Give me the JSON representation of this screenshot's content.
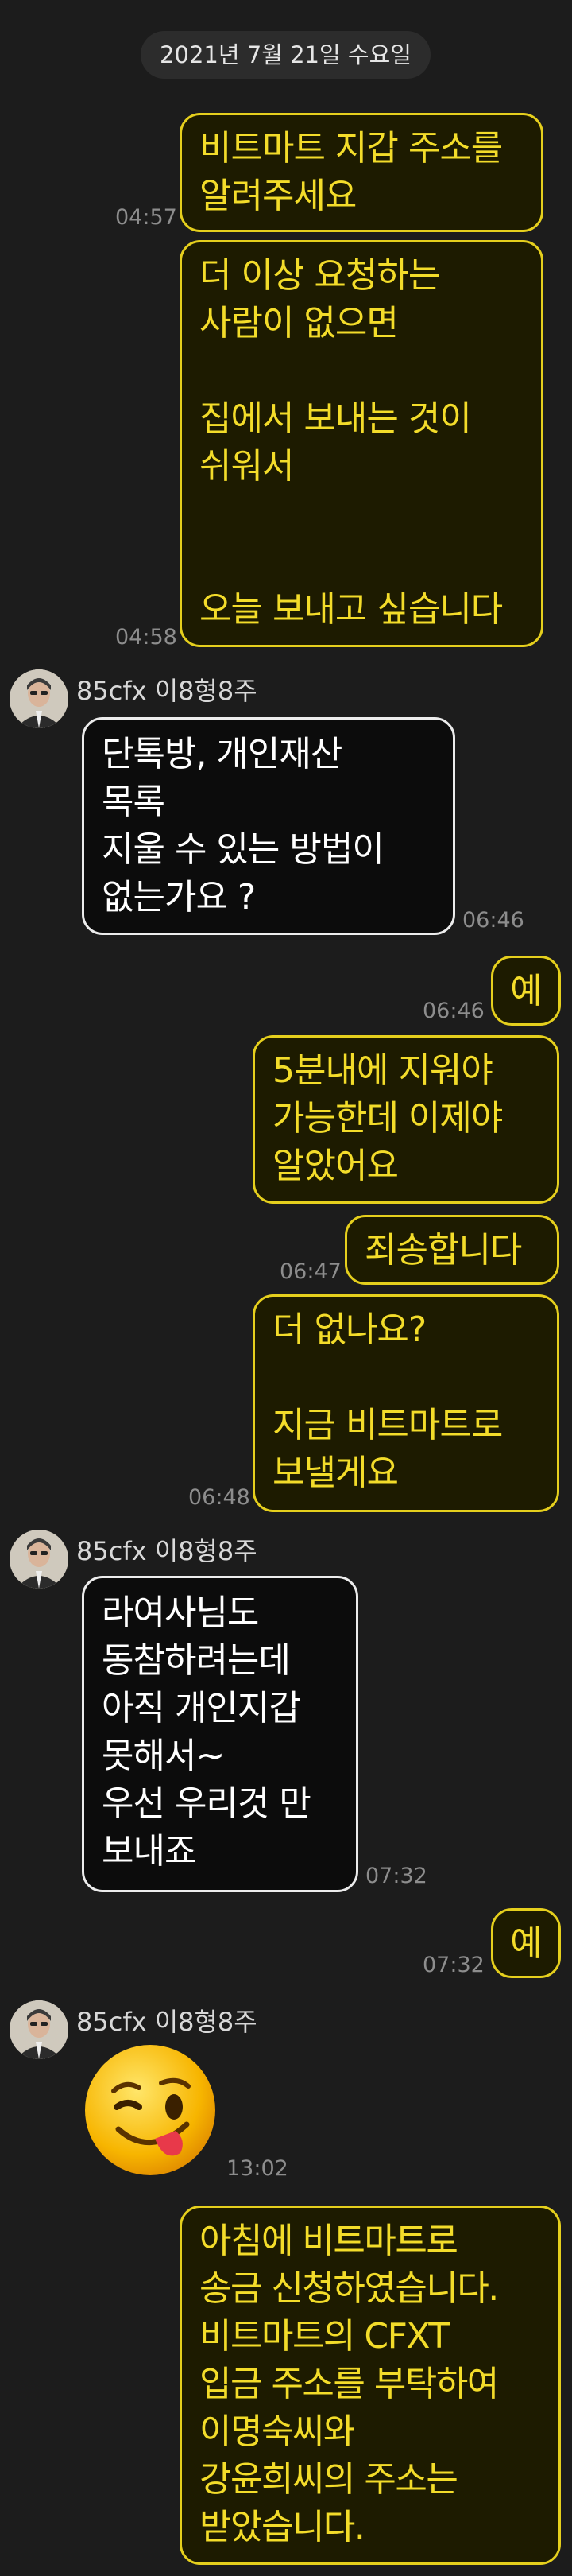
{
  "date_divider": "2021년 7월 21일 수요일",
  "sender_name": "85cfx 이8형8주",
  "messages": [
    {
      "text": "비트마트 지갑 주소를\n알려주세요",
      "time": "04:57"
    },
    {
      "text": "더 이상 요청하는\n사람이 없으면\n\n집에서 보내는 것이\n쉬워서\n\n\n오늘 보내고 싶습니다",
      "time": "04:58"
    },
    {
      "text": "단톡방, 개인재산\n목록\n지울 수 있는 방법이\n없는가요 ?",
      "time": "06:46"
    },
    {
      "text": "예",
      "time": "06:46"
    },
    {
      "text": "5분내에 지워야\n가능한데 이제야\n알았어요",
      "time": ""
    },
    {
      "text": "죄송합니다",
      "time": "06:47"
    },
    {
      "text": "더 없나요?\n\n지금 비트마트로\n보낼게요",
      "time": "06:48"
    },
    {
      "text": "라여사님도\n동참하려는데\n아직 개인지갑\n못해서~\n우선 우리것 만\n보내죠",
      "time": "07:32"
    },
    {
      "text": "예",
      "time": "07:32"
    },
    {
      "text": "",
      "time": "13:02"
    },
    {
      "text": "아침에 비트마트로\n송금 신청하였습니다.\n비트마트의 CFXT\n입금 주소를 부탁하여\n이명숙씨와\n강윤희씨의 주소는\n받았습니다.",
      "time": ""
    }
  ],
  "emoji_icon": "winking-tongue-out-face",
  "colors": {
    "my_bubble_border": "#e5cf1d",
    "my_text": "#f3dc2a",
    "background": "#1c1c1c"
  }
}
